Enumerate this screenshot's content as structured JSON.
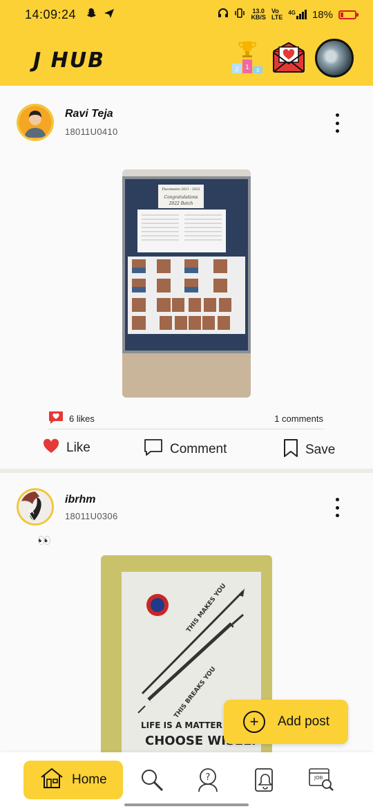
{
  "status_bar": {
    "time": "14:09:24",
    "speed_value": "13.0",
    "speed_unit": "KB/S",
    "network": "4G",
    "battery": "18%",
    "battery_color": "#d21f1f"
  },
  "header": {
    "logo_text": "J HUB",
    "icons": [
      "leaderboard-icon",
      "love-mail-icon",
      "profile-avatar"
    ]
  },
  "posts": [
    {
      "author": "Ravi Teja",
      "user_id": "18011U0410",
      "likes": "6 likes",
      "comments": "1 comments",
      "image_text_1": "Placements 2021 - 2022",
      "image_text_2": "Congratulations",
      "image_text_3": "2022 Batch"
    },
    {
      "author": "ibrhm",
      "user_id": "18011U0306",
      "caption": "👀",
      "image_text_1": "THIS MAKES YOU",
      "image_text_2": "THIS BREAKS YOU",
      "image_text_3": "LIFE IS A MATTER OF CH",
      "image_text_4": "CHOOSE WISELY"
    }
  ],
  "actions": {
    "like": "Like",
    "comment": "Comment",
    "save": "Save"
  },
  "add_post": {
    "label": "Add post"
  },
  "bottom_nav": {
    "home": "Home",
    "items": [
      "home-icon",
      "search-icon",
      "help-icon",
      "notifications-icon",
      "jobs-icon"
    ]
  },
  "colors": {
    "accent": "#fbd135",
    "like_red": "#e53935"
  }
}
